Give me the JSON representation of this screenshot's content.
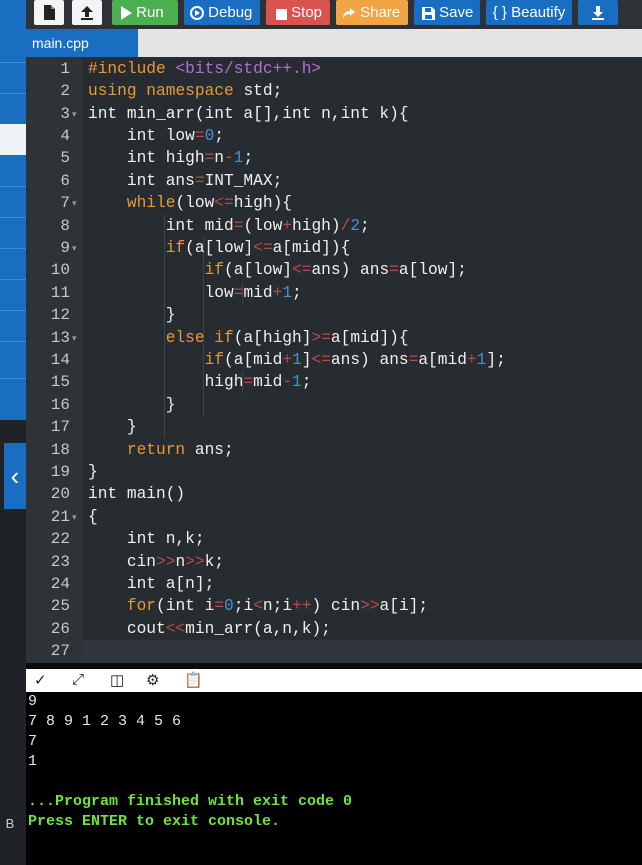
{
  "toolbar": {
    "run": "Run",
    "debug": "Debug",
    "stop": "Stop",
    "share": "Share",
    "save": "Save",
    "beautify": "{ } Beautify",
    "colors": {
      "run": "#4caf50",
      "debug": "#1a6ec2",
      "stop": "#d9534f",
      "share": "#f0a443",
      "save": "#1a6ec2",
      "beautify": "#1a6ec2",
      "download": "#1a6ec2"
    }
  },
  "tab": {
    "file": "main.cpp"
  },
  "editor": {
    "current_line": 27,
    "lines": [
      "#include <bits/stdc++.h>",
      "using namespace std;",
      "int min_arr(int a[],int n,int k){",
      "    int low=0;",
      "    int high=n-1;",
      "    int ans=INT_MAX;",
      "    while(low<=high){",
      "        int mid=(low+high)/2;",
      "        if(a[low]<=a[mid]){",
      "            if(a[low]<=ans) ans=a[low];",
      "            low=mid+1;",
      "        }",
      "        else if(a[high]>=a[mid]){",
      "            if(a[mid+1]<=ans) ans=a[mid+1];",
      "            high=mid-1;",
      "        }",
      "    }",
      "    return ans;",
      "}",
      "int main()",
      "{",
      "    int n,k;",
      "    cin>>n>>k;",
      "    int a[n];",
      "    for(int i=0;i<n;i++) cin>>a[i];",
      "    cout<<min_arr(a,n,k);",
      ""
    ],
    "fold_lines": [
      3,
      7,
      9,
      13,
      21
    ]
  },
  "console": {
    "output": [
      "9",
      "7 8 9 1 2 3 4 5 6",
      "7",
      "1"
    ],
    "finished": "...Program finished with exit code 0",
    "press": "Press ENTER to exit console."
  },
  "sidebar": {
    "edge_label": "B"
  }
}
